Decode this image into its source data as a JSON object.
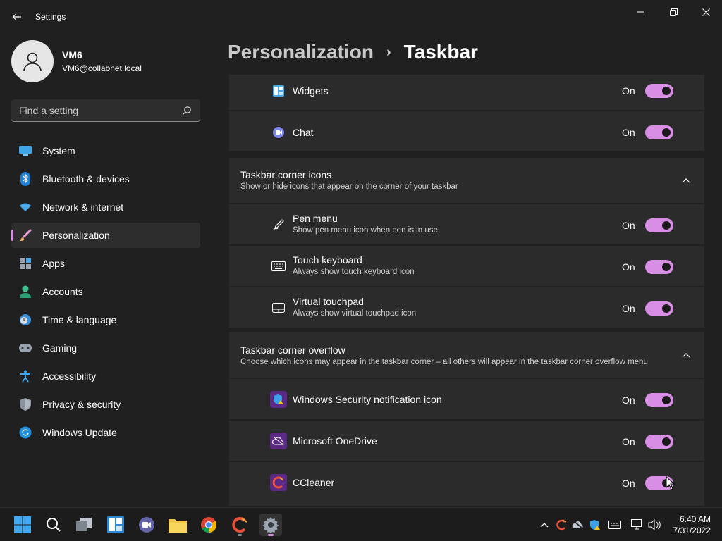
{
  "window": {
    "title": "Settings"
  },
  "profile": {
    "name": "VM6",
    "email": "VM6@collabnet.local"
  },
  "search": {
    "placeholder": "Find a setting"
  },
  "sidebar": {
    "items": [
      {
        "label": "System",
        "icon": "system-icon"
      },
      {
        "label": "Bluetooth & devices",
        "icon": "bluetooth-icon"
      },
      {
        "label": "Network & internet",
        "icon": "wifi-icon"
      },
      {
        "label": "Personalization",
        "icon": "brush-icon",
        "active": true
      },
      {
        "label": "Apps",
        "icon": "apps-icon"
      },
      {
        "label": "Accounts",
        "icon": "accounts-icon"
      },
      {
        "label": "Time & language",
        "icon": "clock-globe-icon"
      },
      {
        "label": "Gaming",
        "icon": "gamepad-icon"
      },
      {
        "label": "Accessibility",
        "icon": "accessibility-icon"
      },
      {
        "label": "Privacy & security",
        "icon": "shield-icon"
      },
      {
        "label": "Windows Update",
        "icon": "update-icon"
      }
    ]
  },
  "breadcrumb": {
    "parent": "Personalization",
    "separator": "›",
    "current": "Taskbar"
  },
  "taskbar_items": {
    "widgets": {
      "label": "Widgets",
      "state": "On"
    },
    "chat": {
      "label": "Chat",
      "state": "On"
    }
  },
  "corner_icons": {
    "title": "Taskbar corner icons",
    "subtitle": "Show or hide icons that appear on the corner of your taskbar",
    "items": [
      {
        "label": "Pen menu",
        "sub": "Show pen menu icon when pen is in use",
        "state": "On"
      },
      {
        "label": "Touch keyboard",
        "sub": "Always show touch keyboard icon",
        "state": "On"
      },
      {
        "label": "Virtual touchpad",
        "sub": "Always show virtual touchpad icon",
        "state": "On"
      }
    ]
  },
  "corner_overflow": {
    "title": "Taskbar corner overflow",
    "subtitle": "Choose which icons may appear in the taskbar corner – all others will appear in the taskbar corner overflow menu",
    "items": [
      {
        "label": "Windows Security notification icon",
        "state": "On"
      },
      {
        "label": "Microsoft OneDrive",
        "state": "On"
      },
      {
        "label": "CCleaner",
        "state": "On"
      }
    ]
  },
  "clock": {
    "time": "6:40 AM",
    "date": "7/31/2022"
  },
  "colors": {
    "accent": "#d98ee6",
    "background": "#202020",
    "card": "#2b2b2b"
  }
}
